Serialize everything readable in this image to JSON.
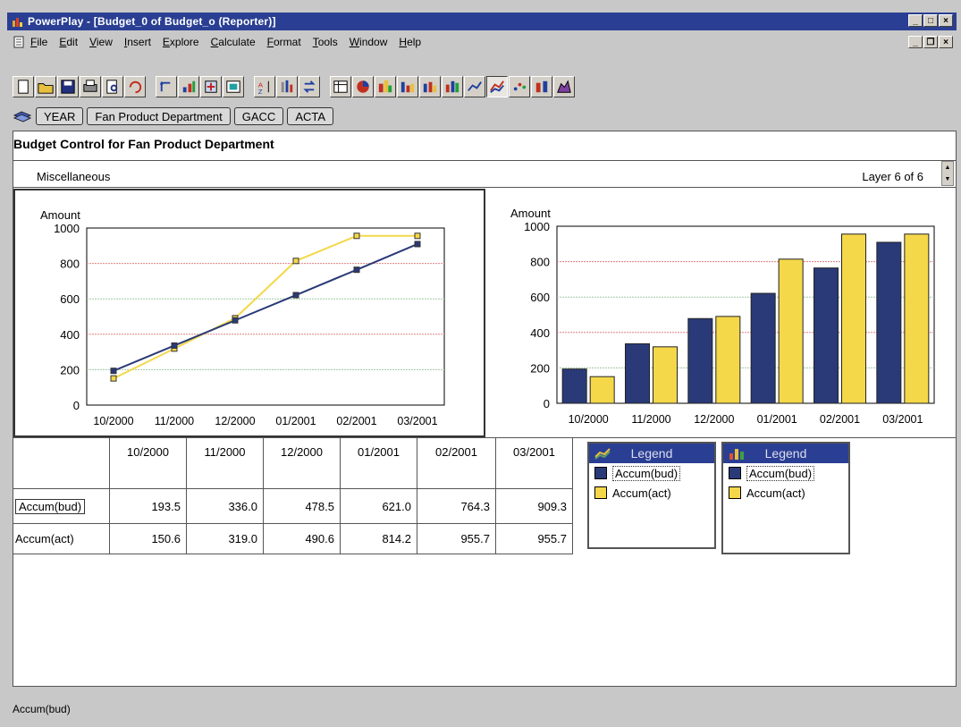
{
  "window": {
    "title": "PowerPlay - [Budget_0 of Budget_o (Reporter)]"
  },
  "menu": [
    "File",
    "Edit",
    "View",
    "Insert",
    "Explore",
    "Calculate",
    "Format",
    "Tools",
    "Window",
    "Help"
  ],
  "toolbar": {
    "buttons": [
      "new-icon",
      "open-icon",
      "save-icon",
      "print-icon",
      "print-preview-icon",
      "undo-icon",
      "drill-up-icon",
      "drill-down-icon",
      "add-icon",
      "explain-icon",
      "sort-icon",
      "filter-icon",
      "swap-icon",
      "crosstab-icon",
      "pie-icon",
      "clustered-bar-icon",
      "simple-bar-icon",
      "stacked-bar-icon",
      "3d-bar-icon",
      "line-chart-icon",
      "multiline-chart-icon",
      "scatter-icon",
      "correlation-icon",
      "3d-chart-icon"
    ],
    "pressed": "multiline-chart-icon"
  },
  "dimension_bar": [
    "YEAR",
    "Fan Product Department",
    "GACC",
    "ACTA"
  ],
  "report": {
    "title": "Budget Control for Fan Product Department",
    "layer_name": "Miscellaneous",
    "layer_count": "Layer 6 of 6"
  },
  "colors": {
    "budget": "#2a3a78",
    "actual": "#f4d84a",
    "titlebar": "#2a3f93"
  },
  "chart_data": [
    {
      "type": "line",
      "ylabel": "Amount",
      "ylim": [
        0,
        1000
      ],
      "yticks": [
        0,
        200,
        400,
        600,
        800,
        1000
      ],
      "categories": [
        "10/2000",
        "11/2000",
        "12/2000",
        "01/2001",
        "02/2001",
        "03/2001"
      ],
      "series": [
        {
          "name": "Accum(bud)",
          "values": [
            193.5,
            336.0,
            478.5,
            621.0,
            764.3,
            909.3
          ]
        },
        {
          "name": "Accum(act)",
          "values": [
            150.6,
            319.0,
            490.6,
            814.2,
            955.7,
            955.7
          ]
        }
      ]
    },
    {
      "type": "bar",
      "ylabel": "Amount",
      "ylim": [
        0,
        1000
      ],
      "yticks": [
        0,
        200,
        400,
        600,
        800,
        1000
      ],
      "categories": [
        "10/2000",
        "11/2000",
        "12/2000",
        "01/2001",
        "02/2001",
        "03/2001"
      ],
      "series": [
        {
          "name": "Accum(bud)",
          "values": [
            193.5,
            336.0,
            478.5,
            621.0,
            764.3,
            909.3
          ]
        },
        {
          "name": "Accum(act)",
          "values": [
            150.6,
            319.0,
            490.6,
            814.2,
            955.7,
            955.7
          ]
        }
      ]
    }
  ],
  "table": {
    "columns": [
      "10/2000",
      "11/2000",
      "12/2000",
      "01/2001",
      "02/2001",
      "03/2001"
    ],
    "rows": [
      {
        "label": "Accum(bud)",
        "values": [
          "193.5",
          "336.0",
          "478.5",
          "621.0",
          "764.3",
          "909.3"
        ]
      },
      {
        "label": "Accum(act)",
        "values": [
          "150.6",
          "319.0",
          "490.6",
          "814.2",
          "955.7",
          "955.7"
        ]
      }
    ]
  },
  "legends": [
    {
      "title": "Legend",
      "icon": "line-chart-icon",
      "items": [
        "Accum(bud)",
        "Accum(act)"
      ]
    },
    {
      "title": "Legend",
      "icon": "bar-chart-icon",
      "items": [
        "Accum(bud)",
        "Accum(act)"
      ]
    }
  ],
  "status": "Accum(bud)"
}
